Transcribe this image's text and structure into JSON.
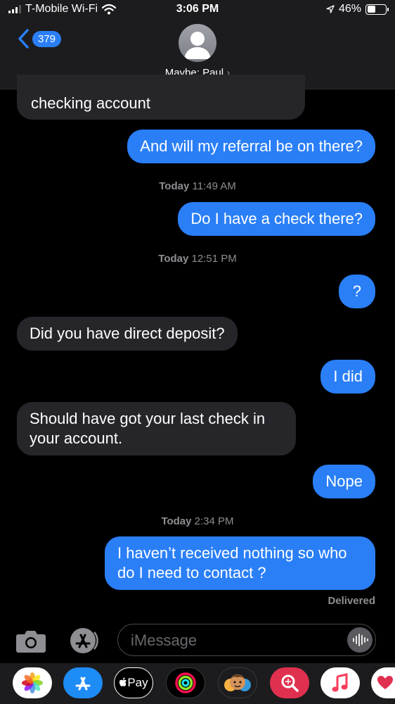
{
  "status_bar": {
    "carrier": "T-Mobile Wi-Fi",
    "time": "3:06 PM",
    "battery": "46%",
    "battery_level": 0.46
  },
  "header": {
    "back_count": "379",
    "contact_name": "Maybe: Paul"
  },
  "messages": [
    {
      "direction": "in",
      "text": "checking account"
    },
    {
      "direction": "out",
      "text": "And will my referral be on there?"
    },
    {
      "type": "timestamp",
      "day": "Today",
      "time": "11:49 AM"
    },
    {
      "direction": "out",
      "text": "Do I have a check there?"
    },
    {
      "type": "timestamp",
      "day": "Today",
      "time": "12:51 PM"
    },
    {
      "direction": "out",
      "text": "?"
    },
    {
      "direction": "in",
      "text": "Did you have direct deposit?"
    },
    {
      "direction": "out",
      "text": "I did"
    },
    {
      "direction": "in",
      "text": "Should have got your last check in your account."
    },
    {
      "direction": "out",
      "text": "Nope"
    },
    {
      "type": "timestamp",
      "day": "Today",
      "time": "2:34 PM"
    },
    {
      "direction": "out",
      "text": "I haven’t received nothing so who do I need to contact ?"
    }
  ],
  "delivered": "Delivered",
  "input": {
    "placeholder": "iMessage"
  },
  "apps": [
    {
      "name": "photos-app-icon"
    },
    {
      "name": "app-store-app-icon"
    },
    {
      "name": "apple-pay-app-icon",
      "label": "Pay"
    },
    {
      "name": "activity-app-icon"
    },
    {
      "name": "memoji-app-icon"
    },
    {
      "name": "image-search-app-icon"
    },
    {
      "name": "music-app-icon"
    },
    {
      "name": "digital-touch-app-icon"
    }
  ],
  "colors": {
    "outgoing": "#2a7ff7",
    "incoming": "#26252a",
    "background": "#000000",
    "header": "#1c1c1e"
  }
}
